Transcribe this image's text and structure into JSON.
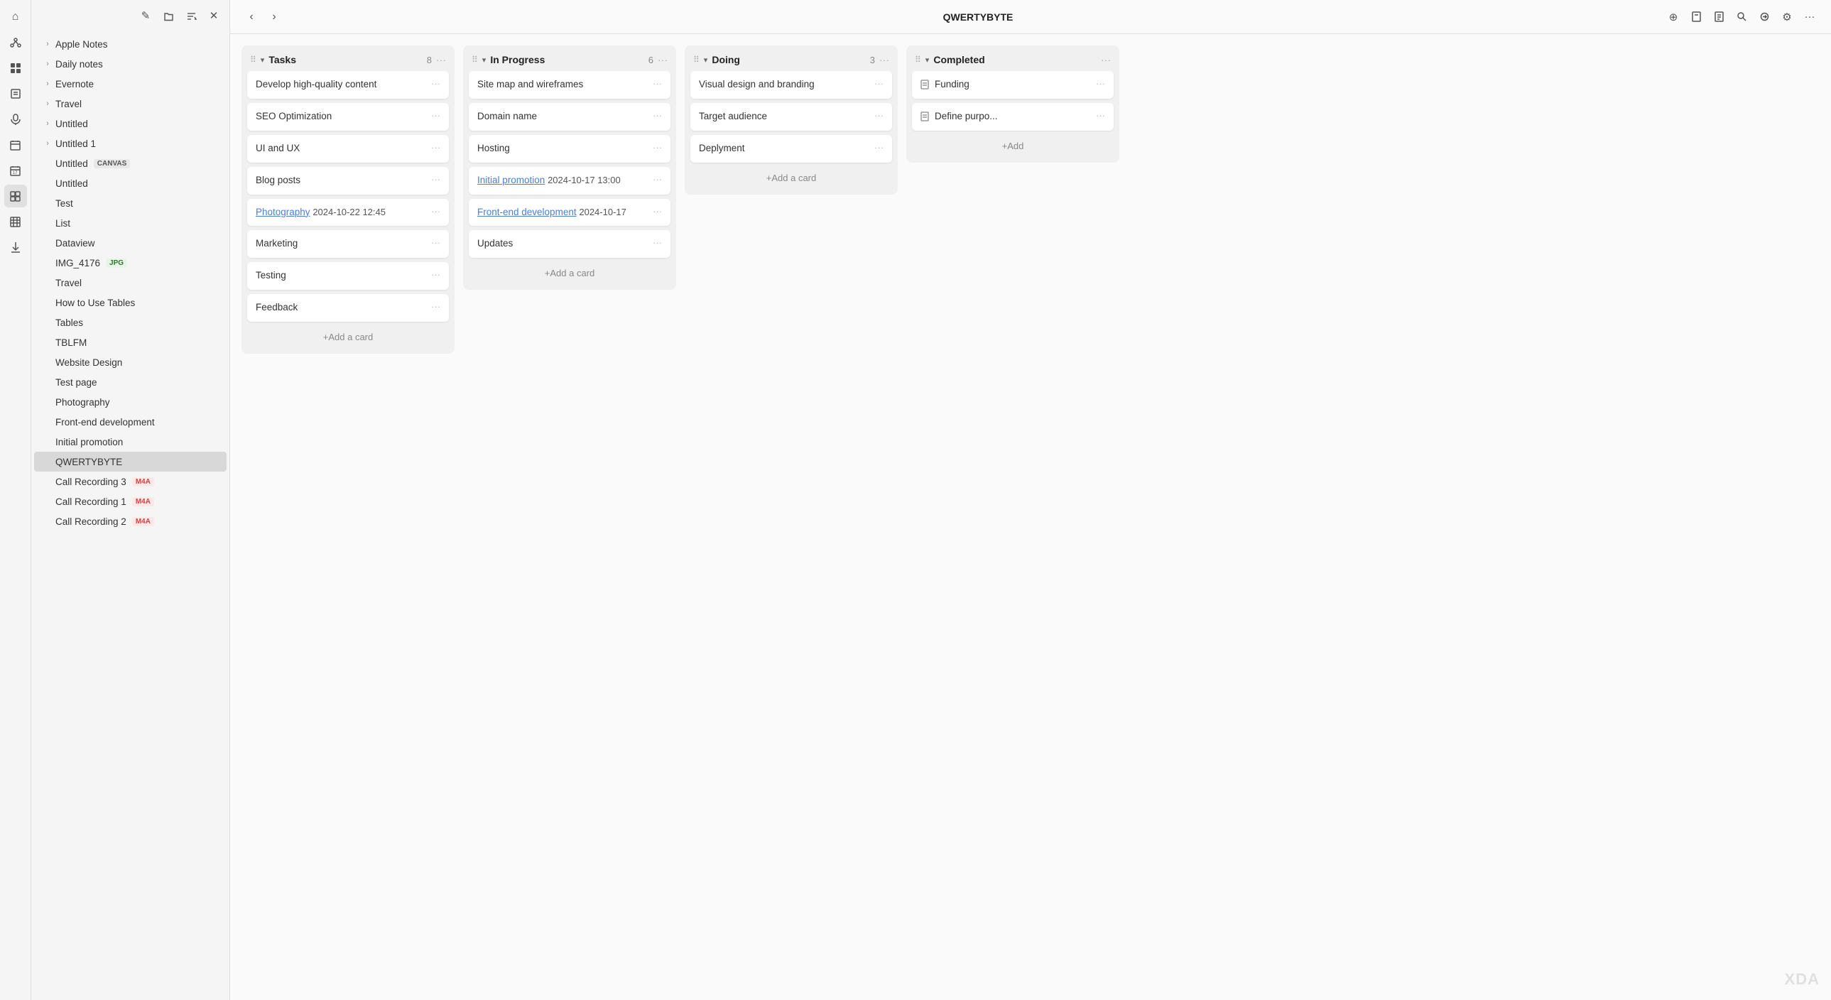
{
  "app_title": "QWERTYBYTE",
  "icon_sidebar": {
    "icons": [
      {
        "name": "home-icon",
        "symbol": "⌂",
        "active": false
      },
      {
        "name": "connections-icon",
        "symbol": "⬡",
        "active": false
      },
      {
        "name": "dashboard-icon",
        "symbol": "▦",
        "active": false
      },
      {
        "name": "pages-icon",
        "symbol": "⊞",
        "active": false
      },
      {
        "name": "mic-icon",
        "symbol": "🎙",
        "active": false
      },
      {
        "name": "calendar-icon",
        "symbol": "📅",
        "active": false
      },
      {
        "name": "date-icon",
        "symbol": "🗓",
        "active": false
      },
      {
        "name": "plugin-icon",
        "symbol": "◧",
        "active": true
      },
      {
        "name": "table-icon",
        "symbol": "⊟",
        "active": false
      },
      {
        "name": "download-icon",
        "symbol": "⬇",
        "active": false
      }
    ]
  },
  "sidebar": {
    "header_buttons": [
      {
        "name": "new-note-btn",
        "symbol": "✎"
      },
      {
        "name": "open-file-btn",
        "symbol": "📁"
      },
      {
        "name": "sort-btn",
        "symbol": "↕"
      },
      {
        "name": "close-sidebar-btn",
        "symbol": "✕"
      }
    ],
    "items": [
      {
        "label": "Apple Notes",
        "type": "folder",
        "indent": 0,
        "chevron": "›"
      },
      {
        "label": "Daily notes",
        "type": "folder",
        "indent": 0,
        "chevron": "›"
      },
      {
        "label": "Evernote",
        "type": "folder",
        "indent": 0,
        "chevron": "›"
      },
      {
        "label": "Travel",
        "type": "folder",
        "indent": 0,
        "chevron": "›"
      },
      {
        "label": "Untitled",
        "type": "folder",
        "indent": 0,
        "chevron": "›"
      },
      {
        "label": "Untitled 1",
        "type": "folder",
        "indent": 0,
        "chevron": "›"
      },
      {
        "label": "Untitled",
        "type": "file",
        "indent": 0,
        "badge": "CANVAS",
        "badge_type": "canvas"
      },
      {
        "label": "Untitled",
        "type": "file",
        "indent": 0
      },
      {
        "label": "Test",
        "type": "file",
        "indent": 0
      },
      {
        "label": "List",
        "type": "file",
        "indent": 0
      },
      {
        "label": "Dataview",
        "type": "file",
        "indent": 0
      },
      {
        "label": "IMG_4176",
        "type": "file",
        "indent": 0,
        "badge": "JPG",
        "badge_type": "jpg",
        "arrow": true
      },
      {
        "label": "Travel",
        "type": "file",
        "indent": 0
      },
      {
        "label": "How to Use Tables",
        "type": "file",
        "indent": 0
      },
      {
        "label": "Tables",
        "type": "file",
        "indent": 0
      },
      {
        "label": "TBLFM",
        "type": "file",
        "indent": 0
      },
      {
        "label": "Website Design",
        "type": "file",
        "indent": 0
      },
      {
        "label": "Test page",
        "type": "file",
        "indent": 0
      },
      {
        "label": "Photography",
        "type": "file",
        "indent": 0
      },
      {
        "label": "Front-end development",
        "type": "file",
        "indent": 0
      },
      {
        "label": "Initial promotion",
        "type": "file",
        "indent": 0
      },
      {
        "label": "QWERTYBYTE",
        "type": "file",
        "indent": 0,
        "active": true
      },
      {
        "label": "Call Recording 3",
        "type": "file",
        "indent": 0,
        "badge": "M4A",
        "badge_type": "m4a"
      },
      {
        "label": "Call Recording 1",
        "type": "file",
        "indent": 0,
        "badge": "M4A",
        "badge_type": "m4a"
      },
      {
        "label": "Call Recording 2",
        "type": "file",
        "indent": 0,
        "badge": "M4A",
        "badge_type": "m4a"
      }
    ]
  },
  "header": {
    "back_label": "‹",
    "forward_label": "›",
    "title": "QWERTYBYTE",
    "actions": [
      {
        "name": "add-btn",
        "symbol": "⊕"
      },
      {
        "name": "bookmark-btn",
        "symbol": "⊟"
      },
      {
        "name": "note-btn",
        "symbol": "📄"
      },
      {
        "name": "search-btn",
        "symbol": "🔍"
      },
      {
        "name": "sync-btn",
        "symbol": "↻"
      },
      {
        "name": "settings-btn",
        "symbol": "⚙"
      },
      {
        "name": "more-btn",
        "symbol": "···"
      }
    ]
  },
  "kanban": {
    "columns": [
      {
        "id": "tasks",
        "title": "Tasks",
        "count": 8,
        "cards": [
          {
            "text": "Develop high-quality content",
            "link": false
          },
          {
            "text": "SEO Optimization",
            "link": false
          },
          {
            "text": "UI and UX",
            "link": false
          },
          {
            "text": "Blog posts",
            "link": false
          },
          {
            "text": "Photography",
            "link": true,
            "link_text": "Photography",
            "date": "2024-10-22 12:45"
          },
          {
            "text": "Marketing",
            "link": false
          },
          {
            "text": "Testing",
            "link": false
          },
          {
            "text": "Feedback",
            "link": false
          }
        ],
        "add_label": "+Add a card"
      },
      {
        "id": "in-progress",
        "title": "In Progress",
        "count": 6,
        "cards": [
          {
            "text": "Site map and wireframes",
            "link": false
          },
          {
            "text": "Domain name",
            "link": false
          },
          {
            "text": "Hosting",
            "link": false
          },
          {
            "text": "Initial promotion",
            "link": true,
            "link_text": "Initial promotion",
            "date": "2024-10-17 13:00"
          },
          {
            "text": "Front-end development",
            "link": true,
            "link_text": "Front-end development",
            "date": "2024-10-17"
          },
          {
            "text": "Updates",
            "link": false
          }
        ],
        "add_label": "+Add a card"
      },
      {
        "id": "doing",
        "title": "Doing",
        "count": 3,
        "cards": [
          {
            "text": "Visual design and branding",
            "link": false,
            "has_icon": true
          },
          {
            "text": "Target audience",
            "link": false
          },
          {
            "text": "Deplyment",
            "link": false
          }
        ],
        "add_label": "+Add a card"
      },
      {
        "id": "completed",
        "title": "Completed",
        "count": null,
        "cards": [
          {
            "text": "Funding",
            "link": false,
            "has_icon": true
          },
          {
            "text": "Define purpo...",
            "link": false,
            "has_icon": true
          }
        ],
        "add_label": "+Add"
      }
    ]
  }
}
